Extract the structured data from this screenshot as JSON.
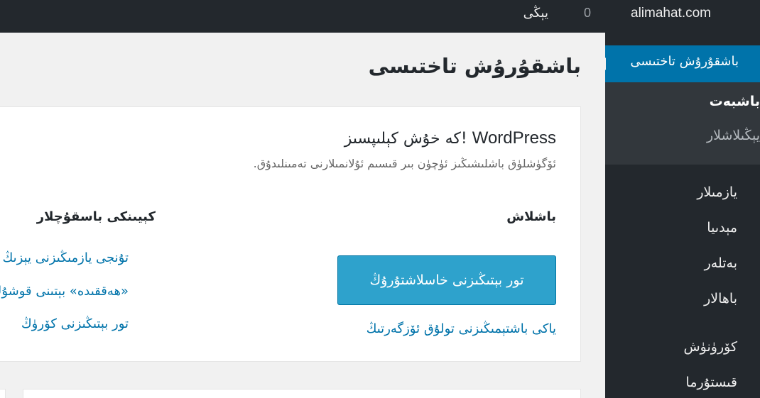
{
  "adminbar": {
    "site_name": "alimahat.com",
    "comment_count": "0",
    "new_label": "يېڭى"
  },
  "sidebar": {
    "current": "باشقۇرۇش تاختىسى",
    "submenu": [
      "باشبەت",
      "يېڭىلاشلار"
    ],
    "items": [
      "يازمىلار",
      "مېدىيا",
      "بەتلەر",
      "باھالار",
      "كۆرۈنۈش",
      "قىستۇرما"
    ]
  },
  "page": {
    "title": "باشقۇرۇش تاختىسى"
  },
  "welcome": {
    "title_brand": "WordPress",
    "title_rest": "كە خۇش كېلىپسىز!",
    "about": "ئۆگۈشلۈق باشلىشىڭىز ئۈچۈن بىر قىسىم ئۇلانمىلارنى تەمىنلىدۇق.",
    "col1_heading": "باشلاش",
    "customize_button": "تور بېتىڭىزنى خاسلاشتۇرۇڭ",
    "theme_link": "ياكى باشتېمىڭىزنى تولۇق ئۆزگەرتىڭ",
    "col2_heading": "كېيىنكى باسقۇچلار",
    "next_steps": [
      "تۇنجى يازمىڭىزنى يېزىڭ",
      "«ھەققىدە» بېتىنى قوشۇڭ",
      "تور بېتىڭىزنى كۆرۈڭ"
    ]
  }
}
